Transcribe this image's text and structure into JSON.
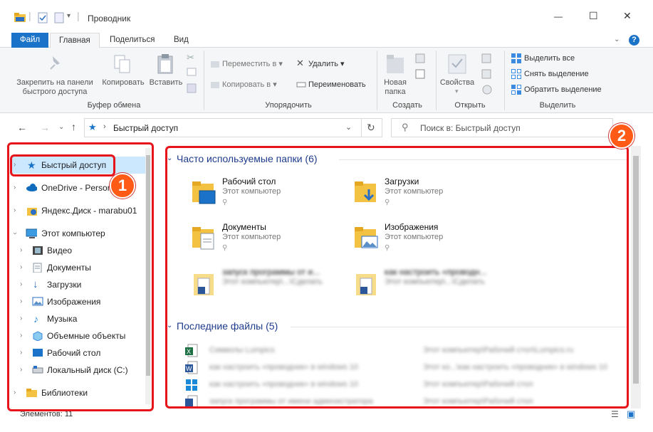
{
  "window": {
    "title": "Проводник",
    "minimize": "—",
    "maximize": "☐",
    "close": "✕",
    "help": "?"
  },
  "tabs": {
    "file": "Файл",
    "home": "Главная",
    "share": "Поделиться",
    "view": "Вид"
  },
  "ribbon": {
    "pin": "Закрепить на панели быстрого доступа",
    "pin_l1": "Закрепить на панели",
    "pin_l2": "быстрого доступа",
    "copy": "Копировать",
    "paste": "Вставить",
    "group_clipboard": "Буфер обмена",
    "move_to": "Переместить в",
    "copy_to": "Копировать в",
    "delete": "Удалить",
    "rename": "Переименовать",
    "group_organize": "Упорядочить",
    "new_folder_l1": "Новая",
    "new_folder_l2": "папка",
    "group_create": "Создать",
    "properties": "Свойства",
    "group_open": "Открыть",
    "select_all": "Выделить все",
    "select_none": "Снять выделение",
    "invert": "Обратить выделение",
    "group_select": "Выделить"
  },
  "address": {
    "path": "Быстрый доступ",
    "search_placeholder": "Поиск в: Быстрый доступ"
  },
  "sidebar": [
    {
      "label": "Быстрый доступ"
    },
    {
      "label": "OneDrive - Person"
    },
    {
      "label": "Яндекс.Диск - marabu01"
    },
    {
      "label": "Этот компьютер"
    },
    {
      "label": "Видео"
    },
    {
      "label": "Документы"
    },
    {
      "label": "Загрузки"
    },
    {
      "label": "Изображения"
    },
    {
      "label": "Музыка"
    },
    {
      "label": "Объемные объекты"
    },
    {
      "label": "Рабочий стол"
    },
    {
      "label": "Локальный диск (C:)"
    },
    {
      "label": "Библиотеки"
    }
  ],
  "frequent": {
    "title": "Часто используемые папки (6)",
    "items": [
      {
        "name": "Рабочий стол",
        "location": "Этот компьютер"
      },
      {
        "name": "Загрузки",
        "location": "Этот компьютер"
      },
      {
        "name": "Документы",
        "location": "Этот компьютер"
      },
      {
        "name": "Изображения",
        "location": "Этот компьютер"
      },
      {
        "name": "запуск программы от и...",
        "location": "Этот компьютер\\...\\Сделать"
      },
      {
        "name": "как настроить «проводн...",
        "location": "Этот компьютер\\...\\Сделать"
      }
    ]
  },
  "recent": {
    "title": "Последние файлы (5)",
    "items": [
      {
        "name": "Символы Lumpics",
        "path": "Этот компьютер\\Рабочий стол\\Lumpics.ru"
      },
      {
        "name": "как настроить «проводник» в windows 10",
        "path": "Этот ко...\\как настроить «проводник» в windows 10"
      },
      {
        "name": "как настроить «проводник» в windows 10",
        "path": "Этот компьютер\\Рабочий стол"
      },
      {
        "name": "запуск программы от имени администратора",
        "path": "Этот компьютер\\Рабочий стол"
      }
    ]
  },
  "status": {
    "count": "Элементов: 11"
  },
  "annotations": {
    "one": "1",
    "two": "2"
  },
  "colors": {
    "accent": "#1a73c8",
    "highlight": "#e8141c",
    "badge": "#ff5a16",
    "selected": "#cce8ff"
  }
}
